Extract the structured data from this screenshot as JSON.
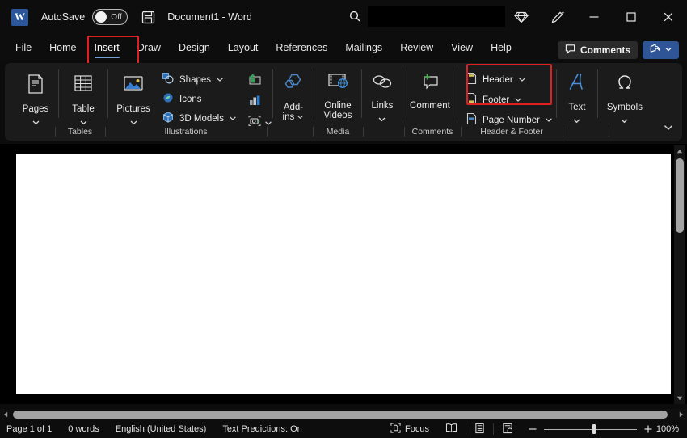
{
  "titlebar": {
    "app_logo": "word-logo",
    "app_logo_letter": "W",
    "autosave_label": "AutoSave",
    "autosave_state": "Off",
    "save_icon": "save-icon",
    "document_title": "Document1  -  Word",
    "search_placeholder": "",
    "search_value": "",
    "search_icon": "search-icon",
    "gem_icon": "diamond-icon",
    "pen_icon": "pen-draw-icon",
    "minimize_label": "minimize-icon",
    "maximize_label": "maximize-icon",
    "close_label": "close-icon"
  },
  "tabs": [
    {
      "label": "File",
      "active": false
    },
    {
      "label": "Home",
      "active": false
    },
    {
      "label": "Insert",
      "active": true
    },
    {
      "label": "Draw",
      "active": false
    },
    {
      "label": "Design",
      "active": false
    },
    {
      "label": "Layout",
      "active": false
    },
    {
      "label": "References",
      "active": false
    },
    {
      "label": "Mailings",
      "active": false
    },
    {
      "label": "Review",
      "active": false
    },
    {
      "label": "View",
      "active": false
    },
    {
      "label": "Help",
      "active": false
    }
  ],
  "tab_actions": {
    "comments_label": "Comments",
    "comments_icon": "comment-bubble-icon",
    "share_icon": "share-icon",
    "share_chevron": "chevron-down-icon"
  },
  "highlights": {
    "insert_tab_box_color": "#e02020",
    "header_footer_box_color": "#e02020"
  },
  "ribbon": {
    "groups": [
      {
        "name": "Pages",
        "label": "",
        "buttons": [
          {
            "label": "Pages",
            "icon": "pages-icon",
            "has_dropdown": true
          }
        ]
      },
      {
        "name": "Tables",
        "label": "Tables",
        "buttons": [
          {
            "label": "Table",
            "icon": "table-icon",
            "has_dropdown": true
          }
        ]
      },
      {
        "name": "Illustrations",
        "label": "Illustrations",
        "buttons": [
          {
            "label": "Pictures",
            "icon": "pictures-icon",
            "has_dropdown": true
          }
        ],
        "small_buttons": [
          {
            "label": "Shapes",
            "icon": "shapes-icon",
            "has_dropdown": true
          },
          {
            "label": "Icons",
            "icon": "icons-icon",
            "has_dropdown": false
          },
          {
            "label": "3D Models",
            "icon": "3d-models-icon",
            "has_dropdown": true
          }
        ],
        "icon_only_buttons": [
          {
            "label": "SmartArt",
            "icon": "smartart-icon",
            "has_dropdown": false
          },
          {
            "label": "Chart",
            "icon": "chart-icon",
            "has_dropdown": false
          },
          {
            "label": "Screenshot",
            "icon": "screenshot-icon",
            "has_dropdown": true
          }
        ]
      },
      {
        "name": "Add-ins",
        "label": "",
        "buttons": [
          {
            "label": "Add-ins",
            "icon": "addins-icon",
            "has_dropdown": true
          }
        ]
      },
      {
        "name": "Media",
        "label": "Media",
        "buttons": [
          {
            "label": "Online Videos",
            "icon": "online-videos-icon",
            "has_dropdown": false
          }
        ]
      },
      {
        "name": "Comments",
        "label": "Comments",
        "buttons": [
          {
            "label": "Links",
            "icon": "links-icon",
            "has_dropdown": true
          },
          {
            "label": "Comment",
            "icon": "new-comment-icon",
            "has_dropdown": false
          }
        ]
      },
      {
        "name": "Header & Footer",
        "label": "Header & Footer",
        "small_buttons": [
          {
            "label": "Header",
            "icon": "header-icon",
            "has_dropdown": true
          },
          {
            "label": "Footer",
            "icon": "footer-icon",
            "has_dropdown": true
          },
          {
            "label": "Page Number",
            "icon": "page-number-icon",
            "has_dropdown": true
          }
        ]
      },
      {
        "name": "Text",
        "label": "",
        "buttons": [
          {
            "label": "Text",
            "icon": "text-icon",
            "has_dropdown": true
          }
        ]
      },
      {
        "name": "Symbols",
        "label": "",
        "buttons": [
          {
            "label": "Symbols",
            "icon": "omega-symbol-icon",
            "has_dropdown": true
          }
        ]
      }
    ],
    "collapse_icon": "chevron-down-icon"
  },
  "labels": {
    "tables": "Tables",
    "illustrations": "Illustrations",
    "media": "Media",
    "comments": "Comments",
    "header_footer": "Header & Footer"
  },
  "buttons": {
    "pages": "Pages",
    "table": "Table",
    "pictures": "Pictures",
    "shapes": "Shapes",
    "icons": "Icons",
    "models3d": "3D Models",
    "addins": "Add-ins",
    "addins_line1": "Add-",
    "addins_line2": "ins",
    "online_videos_line1": "Online",
    "online_videos_line2": "Videos",
    "links": "Links",
    "comment": "Comment",
    "header": "Header",
    "footer": "Footer",
    "page_number": "Page Number",
    "text": "Text",
    "symbols": "Symbols"
  },
  "statusbar": {
    "page_info": "Page 1 of 1",
    "word_count": "0 words",
    "language": "English (United States)",
    "text_predictions": "Text Predictions: On",
    "focus_label": "Focus",
    "focus_icon": "focus-mode-icon",
    "read_mode_icon": "read-mode-icon",
    "print_layout_icon": "print-layout-icon",
    "web_layout_icon": "web-layout-icon",
    "zoom_out_icon": "zoom-out-icon",
    "zoom_in_icon": "zoom-in-icon",
    "zoom_level": "100%"
  },
  "scrollbars": {
    "vertical_up_icon": "scroll-up-arrow",
    "vertical_down_icon": "scroll-down-arrow",
    "horizontal_left_icon": "scroll-left-arrow",
    "horizontal_right_icon": "scroll-right-arrow"
  },
  "colors": {
    "accent_blue": "#2f5597",
    "highlight_red": "#e02020",
    "ribbon_bg": "#1b1b1b",
    "page_white": "#ffffff"
  }
}
